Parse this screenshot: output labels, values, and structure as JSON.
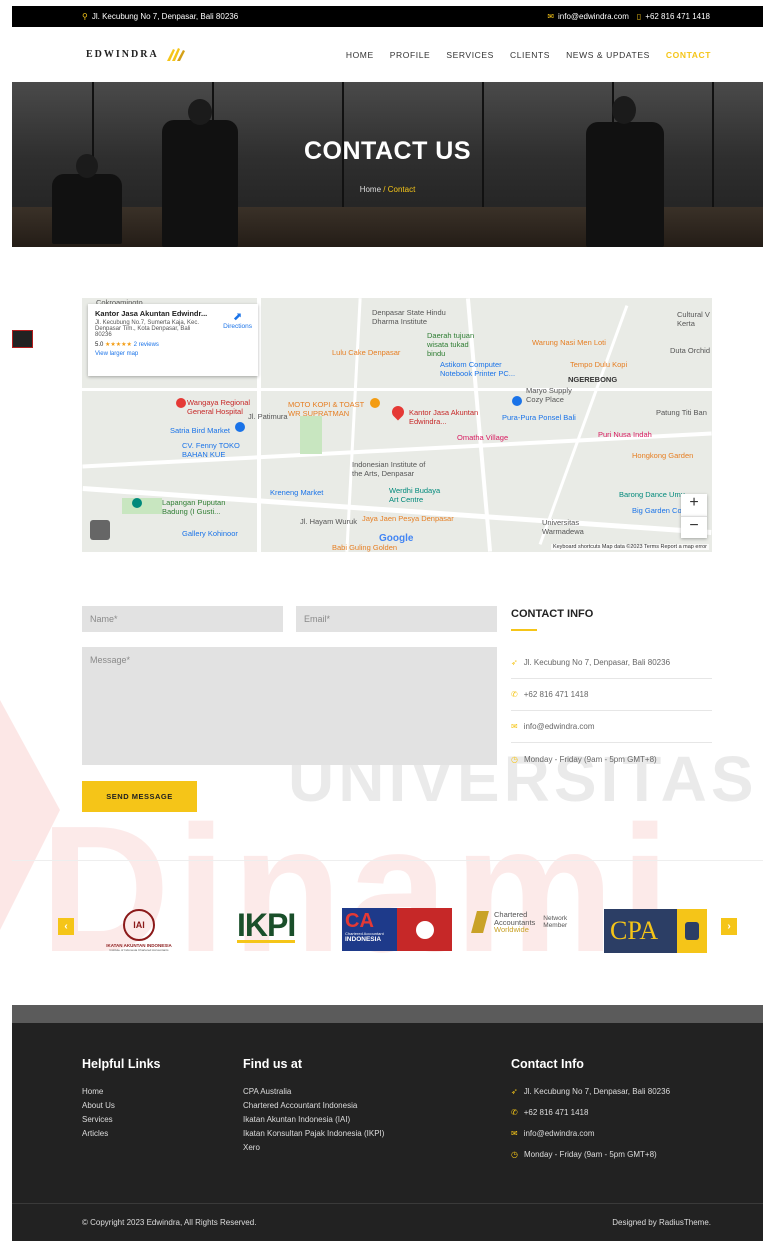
{
  "topbar": {
    "address": "Jl. Kecubung No 7, Denpasar, Bali 80236",
    "email": "info@edwindra.com",
    "phone": "+62 816 471 1418"
  },
  "header": {
    "logo_text": "EDWINDRA",
    "nav": [
      "HOME",
      "PROFILE",
      "SERVICES",
      "CLIENTS",
      "NEWS & UPDATES",
      "CONTACT"
    ]
  },
  "hero": {
    "title": "CONTACT US",
    "breadcrumb_home": "Home",
    "breadcrumb_sep": "/",
    "breadcrumb_current": "Contact"
  },
  "map": {
    "card_title": "Kantor Jasa Akuntan Edwindr...",
    "card_address": "Jl. Kecubung No.7, Sumerta Kaja, Kec. Denpasar Tim., Kota Denpasar, Bali 80236",
    "rating": "5.0",
    "stars": "★★★★★",
    "reviews": "2 reviews",
    "larger_map": "View larger map",
    "directions": "Directions",
    "labels": {
      "cokroaminoto": "Cokroaminoto",
      "dharma": "Denpasar State Hindu Dharma Institute",
      "daerah": "Daerah tujuan wisata tukad bindu",
      "warung": "Warung Nasi Men Loti",
      "cultural": "Cultural V Kerta",
      "lulu": "Lulu Cake Denpasar",
      "astikom": "Astikom Computer Notebook Printer PC...",
      "tempo": "Tempo Dulu Kopi",
      "duta": "Duta Orchid",
      "ngerebong": "NGEREBONG",
      "maryo": "Maryo Supply Cozy Place",
      "wangaya": "Wangaya Regional General Hospital",
      "motokopi": "MOTO KOPI & TOAST WR SUPRATMAN",
      "kantor": "Kantor Jasa Akuntan Edwindra...",
      "purapura": "Pura-Pura Ponsel Bali",
      "patung": "Patung Titi Ban",
      "satria": "Satria Bird Market",
      "omatha": "Omatha Village",
      "purinusa": "Puri Nusa Indah",
      "cvfenny": "CV. Fenny TOKO BAHAN KUE",
      "hongkong": "Hongkong Garden",
      "indonesian": "Indonesian Institute of the Arts, Denpasar",
      "kreneng": "Kreneng Market",
      "werdhi": "Werdhi Budaya Art Centre",
      "barong": "Barong Dance Umu",
      "lapangan": "Lapangan Puputan Badung (I Gusti...",
      "biggarden": "Big Garden Co",
      "jaya": "Jaya Jaen Pesya Denpasar",
      "universitas": "Universitas Warmadewa",
      "gallery": "Gallery Kohinoor",
      "babiguling": "Babi Guling Golden",
      "hayam": "Jl. Hayam Wuruk",
      "patimura": "Jl. Patimura",
      "google": "Google"
    },
    "zoom_in": "+",
    "zoom_out": "−",
    "footer": "Keyboard shortcuts   Map data ©2023   Terms   Report a map error"
  },
  "form": {
    "name_placeholder": "Name*",
    "email_placeholder": "Email*",
    "message_placeholder": "Message*",
    "send_label": "SEND MESSAGE"
  },
  "contact_info": {
    "title": "CONTACT INFO",
    "address": "Jl. Kecubung No 7, Denpasar, Bali 80236",
    "phone": "+62 816 471 1418",
    "email": "info@edwindra.com",
    "hours": "Monday - Friday (9am - 5pm GMT+8)"
  },
  "watermark": {
    "line1": "UNIVERSITAS",
    "line2": "Dinami"
  },
  "partners": {
    "prev": "‹",
    "next": "›",
    "iai_caption": "IKATAN AKUNTAN INDONESIA",
    "iai_sub": "Institute of Indonesia Chartered Accountants",
    "iai_glyph": "IAI",
    "ikpi": "IKPI",
    "ca_letters": "CA",
    "ca_sub": "Chartered Accountant",
    "ca_country": "INDONESIA",
    "cai_line1": "Chartered",
    "cai_line2": "Accountants",
    "cai_line3": "Worldwide",
    "cai_net1": "Network",
    "cai_net2": "Member",
    "cpa": "CPA"
  },
  "footer": {
    "helpful_title": "Helpful Links",
    "helpful_links": [
      "Home",
      "About Us",
      "Services",
      "Articles"
    ],
    "find_title": "Find us at",
    "find_links": [
      "CPA Australia",
      "Chartered Accountant Indonesia",
      "Ikatan Akuntan Indonesia (IAI)",
      "Ikatan Konsultan Pajak Indonesia (IKPI)",
      "Xero"
    ],
    "contact_title": "Contact Info",
    "address": "Jl. Kecubung No 7, Denpasar, Bali 80236",
    "phone": "+62 816 471 1418",
    "email": "info@edwindra.com",
    "hours": "Monday - Friday (9am - 5pm GMT+8)",
    "copyright": "© Copyright 2023 Edwindra, All Rights Reserved.",
    "designed": "Designed by RadiusTheme."
  },
  "colors": {
    "accent": "#f5c518",
    "dark": "#222222",
    "map_pin": "#e53935"
  }
}
